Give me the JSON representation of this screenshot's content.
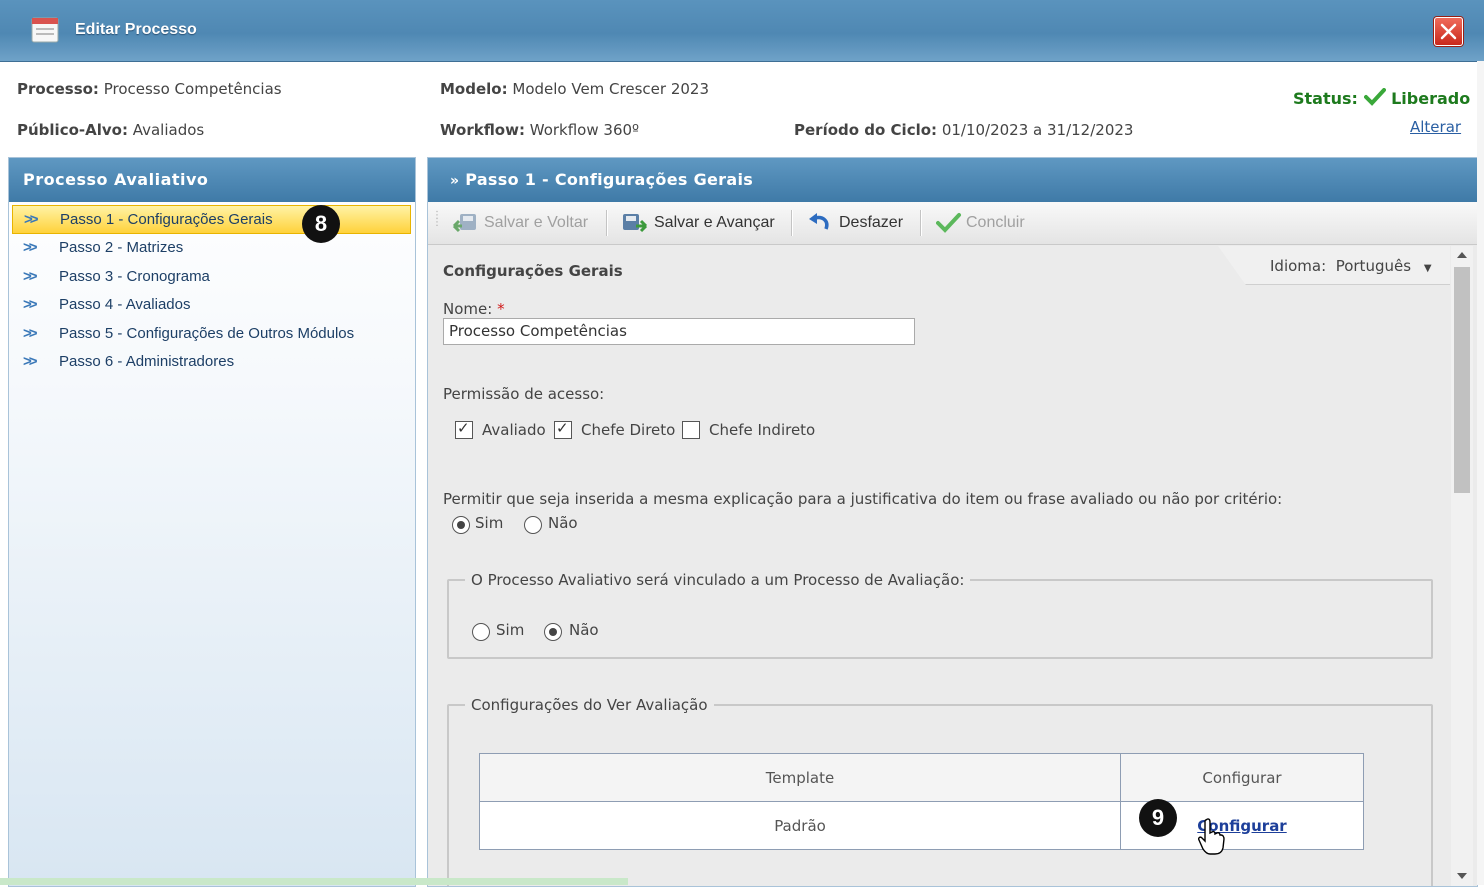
{
  "window": {
    "title": "Editar Processo"
  },
  "header": {
    "processo_label": "Processo:",
    "processo_value": "Processo Competências",
    "modelo_label": "Modelo:",
    "modelo_value": "Modelo Vem Crescer 2023",
    "publico_label": "Público-Alvo:",
    "publico_value": "Avaliados",
    "workflow_label": "Workflow:",
    "workflow_value": "Workflow 360º",
    "periodo_label": "Período do Ciclo:",
    "periodo_value": "01/10/2023 a 31/12/2023",
    "status_label": "Status",
    "status_value": "Liberado",
    "alterar": "Alterar"
  },
  "sidebar": {
    "title": "Processo Avaliativo",
    "items": [
      {
        "label": "Passo 1 - Configurações Gerais"
      },
      {
        "label": "Passo 2 - Matrizes"
      },
      {
        "label": "Passo 3 - Cronograma"
      },
      {
        "label": "Passo 4 - Avaliados"
      },
      {
        "label": "Passo 5 - Configurações de Outros Módulos"
      },
      {
        "label": "Passo 6 - Administradores"
      }
    ],
    "active_index": 0
  },
  "badges": {
    "b8": "8",
    "b9": "9"
  },
  "main": {
    "header": "Passo 1 - Configurações Gerais",
    "toolbar": {
      "salvar_voltar": "Salvar e Voltar",
      "salvar_avancar": "Salvar e Avançar",
      "desfazer": "Desfazer",
      "concluir": "Concluir"
    },
    "section_title": "Configurações Gerais",
    "idioma_label": "Idioma:",
    "idioma_value": "Português",
    "nome_label": "Nome:",
    "nome_required": "*",
    "nome_value": "Processo Competências",
    "permissao_label": "Permissão de acesso:",
    "permissoes": [
      {
        "label": "Avaliado",
        "checked": true
      },
      {
        "label": "Chefe Direto",
        "checked": true
      },
      {
        "label": "Chefe Indireto",
        "checked": false
      }
    ],
    "permitir_label": "Permitir que seja inserida a mesma explicação para a justificativa do item ou frase avaliado ou não por critério:",
    "permitir_sim": "Sim",
    "permitir_nao": "Não",
    "permitir_selected": "Sim",
    "vinculo_legend": "O Processo Avaliativo será vinculado a um Processo de Avaliação:",
    "vinculo_sim": "Sim",
    "vinculo_nao": "Não",
    "vinculo_selected": "Não",
    "ver_avaliacao_legend": "Configurações do Ver Avaliação",
    "table": {
      "headers": [
        "Template",
        "Configurar"
      ],
      "rows": [
        {
          "template": "Padrão",
          "configurar": "Configurar"
        }
      ]
    }
  },
  "colors": {
    "accent": "#4f88b3",
    "active_step": "#ffd23b",
    "status": "#1d7a1d"
  }
}
